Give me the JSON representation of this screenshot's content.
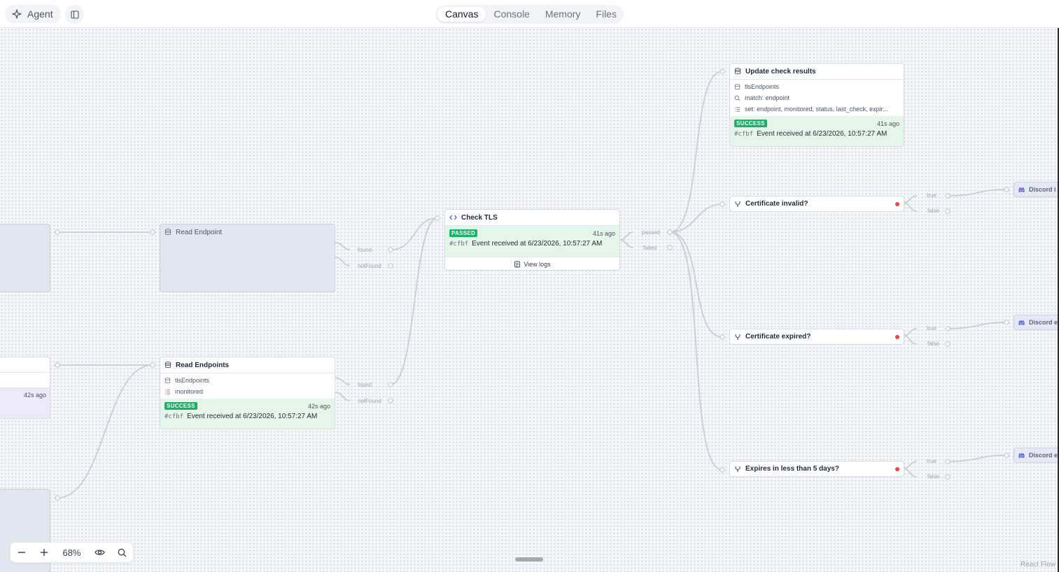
{
  "header": {
    "agent_label": "Agent",
    "tabs": [
      {
        "label": "Canvas",
        "active": true
      },
      {
        "label": "Console",
        "active": false
      },
      {
        "label": "Memory",
        "active": false
      },
      {
        "label": "Files",
        "active": false
      }
    ]
  },
  "nodes": {
    "read_endpoint": {
      "title": "Read Endpoint"
    },
    "read_endpoints": {
      "title": "Read Endpoints",
      "rows": [
        "tlsEndpoints",
        "monitored"
      ],
      "status": "SUCCESS",
      "ago": "42s ago",
      "hash": "#cfbf",
      "event": "Event received at 6/23/2026, 10:57:27 AM"
    },
    "left_partial_ago": "42s ago",
    "check_tls": {
      "title": "Check TLS",
      "status": "PASSED",
      "ago": "41s ago",
      "hash": "#cfbf",
      "event": "Event received at 6/23/2026, 10:57:27 AM",
      "view_logs": "View logs"
    },
    "update_results": {
      "title": "Update check results",
      "rows": [
        "tlsEndpoints",
        "match: endpoint",
        "set: endpoint, monitored, status, last_check, expir..."
      ],
      "status": "SUCCESS",
      "ago": "41s ago",
      "hash": "#cfbf",
      "event": "Event received at 6/23/2026, 10:57:27 AM"
    },
    "cond_invalid": {
      "title": "Certificate invalid?"
    },
    "cond_expired": {
      "title": "Certificate expired?"
    },
    "cond_expires_soon": {
      "title": "Expires in less than 5 days?"
    },
    "discord_1": {
      "title": "Discord i"
    },
    "discord_2": {
      "title": "Discord e"
    },
    "discord_3": {
      "title": "Discord e"
    }
  },
  "edge_labels": {
    "found": "found",
    "notFound": "notFound",
    "passed": "passed",
    "failed": "failed",
    "true": "true",
    "false": "false"
  },
  "controls": {
    "zoom": "68%"
  },
  "attribution": "React Flow",
  "colors": {
    "success": "#15b365",
    "status_bg": "#e4f6e9",
    "error_dot": "#ef4444",
    "discord": "#6b73d6"
  }
}
